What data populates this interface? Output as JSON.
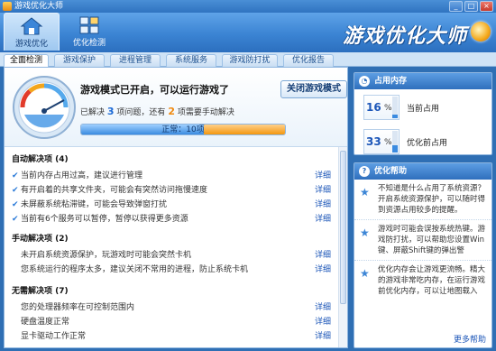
{
  "window": {
    "title": "游戏优化大师",
    "min": "_",
    "max": "□",
    "close": "×"
  },
  "header": {
    "tabs": [
      {
        "label": "游戏优化",
        "icon": "home-icon",
        "active": true
      },
      {
        "label": "优化检测",
        "icon": "grid-icon",
        "active": false
      }
    ],
    "brand": "游戏优化大师"
  },
  "subtabs": [
    {
      "label": "全面检测",
      "active": true
    },
    {
      "label": "游戏保护"
    },
    {
      "label": "进程管理"
    },
    {
      "label": "系统服务"
    },
    {
      "label": "游戏防打扰"
    },
    {
      "label": "优化报告"
    }
  ],
  "summary": {
    "status": "游戏模式已开启，可以运行游戏了",
    "resolved_prefix": "已解决",
    "resolved_count": "3",
    "resolved_suffix": "项问题，还有",
    "remaining_count": "2",
    "remaining_suffix": "项需要手动解决",
    "close_button": "关闭游戏模式",
    "progress_text": "正常：10项",
    "progress_fraction": 0.6
  },
  "sections": [
    {
      "title": "自动解决项 (4)",
      "rows": [
        {
          "text": "当前内存占用过高，建议进行管理",
          "detail": "详细",
          "checked": true
        },
        {
          "text": "有开启着的共享文件夹，可能会有突然访问拖慢速度",
          "detail": "详细",
          "checked": true
        },
        {
          "text": "未屏蔽系统粘滞键，可能会导致弹窗打扰",
          "detail": "详细",
          "checked": true
        },
        {
          "text": "当前有6个服务可以暂停，暂停以获得更多资源",
          "detail": "详细",
          "checked": true
        }
      ]
    },
    {
      "title": "手动解决项 (2)",
      "rows": [
        {
          "text": "未开启系统资源保护，玩游戏时可能会突然卡机",
          "detail": "详细"
        },
        {
          "text": "您系统运行的程序太多，建议关闭不常用的进程，防止系统卡机",
          "detail": "详细"
        }
      ]
    },
    {
      "title": "无需解决项 (7)",
      "rows": [
        {
          "text": "您的处理器频率在可控制范围内",
          "detail": "详细"
        },
        {
          "text": "硬盘温度正常",
          "detail": "详细"
        },
        {
          "text": "显卡驱动工作正常",
          "detail": "详细"
        }
      ]
    }
  ],
  "memory": {
    "title": "占用内存",
    "items": [
      {
        "value": "16",
        "unit": "%",
        "label": "当前占用",
        "fraction": 0.16
      },
      {
        "value": "33",
        "unit": "%",
        "label": "优化前占用",
        "fraction": 0.33
      }
    ]
  },
  "help": {
    "title": "优化帮助",
    "tips": [
      "不知道是什么占用了系统资源？开启系统资源保护，可以随时得到资源占用较多的提醒。",
      "游戏时可能会误按系统热键。游戏防打扰，可以帮助您设置Win键、屏蔽Shift键的弹出警",
      "优化内存会让游戏更流畅。精大的游戏非常吃内存，在运行游戏前优化内存，可以让地图载入"
    ],
    "more": "更多帮助"
  },
  "colors": {
    "accent": "#2f6fb4",
    "orange": "#f08a10",
    "link": "#1c56b8"
  }
}
